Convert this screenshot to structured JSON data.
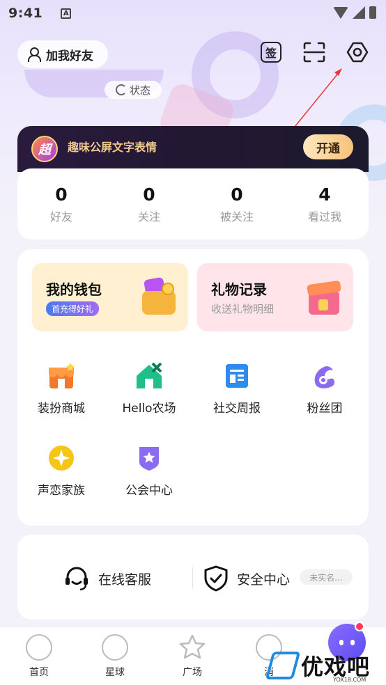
{
  "status_bar": {
    "time": "9:41",
    "notif_glyph": "A"
  },
  "header": {
    "add_friend_label": "加我好友",
    "sign_label": "签",
    "status_label": "状态"
  },
  "vip": {
    "badge": "超",
    "text": "趣味公屏文字表情",
    "button": "开通"
  },
  "stats": [
    {
      "num": "0",
      "label": "好友"
    },
    {
      "num": "0",
      "label": "关注"
    },
    {
      "num": "0",
      "label": "被关注"
    },
    {
      "num": "4",
      "label": "看过我"
    }
  ],
  "features": {
    "wallet": {
      "title": "我的钱包",
      "badge": "首充得好礼"
    },
    "gift": {
      "title": "礼物记录",
      "subtitle": "收送礼物明细"
    }
  },
  "grid": [
    {
      "label": "装扮商城",
      "icon": "shop-icon",
      "color": "#f07a2a"
    },
    {
      "label": "Hello农场",
      "icon": "farm-house-icon",
      "color": "#1fbf8a"
    },
    {
      "label": "社交周报",
      "icon": "report-icon",
      "color": "#2e8cf0"
    },
    {
      "label": "粉丝团",
      "icon": "fan-club-icon",
      "color": "#8b6bf0"
    },
    {
      "label": "声恋家族",
      "icon": "family-star-icon",
      "color": "#f5c518"
    },
    {
      "label": "公会中心",
      "icon": "guild-shield-icon",
      "color": "#8b6bf0"
    }
  ],
  "services": {
    "support": "在线客服",
    "security": "安全中心",
    "verify": "未实名..."
  },
  "tabs": [
    {
      "label": "首页"
    },
    {
      "label": "星球"
    },
    {
      "label": "广场"
    },
    {
      "label": "消"
    }
  ],
  "watermark": {
    "text": "优戏吧",
    "url": "YOX18.COM"
  }
}
